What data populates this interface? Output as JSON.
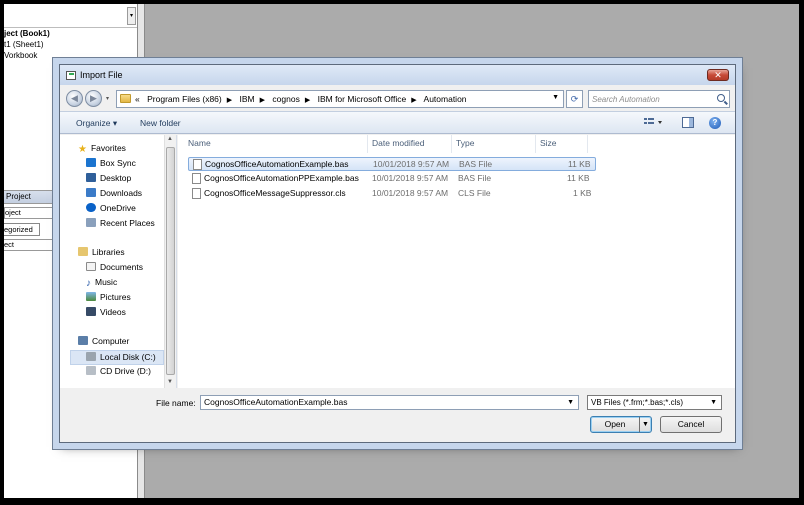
{
  "vba_pane": {
    "project_line": "ject (Book1)",
    "sheet_line": "t1 (Sheet1)",
    "workbook_line": "Vorkbook",
    "props_header": "Project",
    "props_combo": "oject",
    "props_tab": "egorized",
    "props_row": "ect"
  },
  "dialog": {
    "title": "Import File",
    "close_label": "✕",
    "address": {
      "crumbs": [
        "Program Files (x86)",
        "IBM",
        "cognos",
        "IBM for Microsoft Office",
        "Automation"
      ],
      "overflow": "«"
    },
    "search": {
      "placeholder": "Search Automation"
    },
    "toolbar": {
      "organize": "Organize ▾",
      "new_folder": "New folder",
      "help": "?"
    },
    "nav": {
      "favorites": "Favorites",
      "box_sync": "Box Sync",
      "desktop": "Desktop",
      "downloads": "Downloads",
      "onedrive": "OneDrive",
      "recent_places": "Recent Places",
      "libraries": "Libraries",
      "documents": "Documents",
      "music": "Music",
      "pictures": "Pictures",
      "videos": "Videos",
      "computer": "Computer",
      "local_disk": "Local Disk (C:)",
      "cd_drive": "CD Drive (D:)"
    },
    "columns": {
      "name": "Name",
      "date": "Date modified",
      "type": "Type",
      "size": "Size"
    },
    "files": [
      {
        "name": "CognosOfficeAutomationExample.bas",
        "date": "10/01/2018 9:57 AM",
        "type": "BAS File",
        "size": "11 KB"
      },
      {
        "name": "CognosOfficeAutomationPPExample.bas",
        "date": "10/01/2018 9:57 AM",
        "type": "BAS File",
        "size": "11 KB"
      },
      {
        "name": "CognosOfficeMessageSuppressor.cls",
        "date": "10/01/2018 9:57 AM",
        "type": "CLS File",
        "size": "1 KB"
      }
    ],
    "file_name_label": "File name:",
    "file_name_value": "CognosOfficeAutomationExample.bas",
    "file_type": "VB Files (*.frm;*.bas;*.cls)",
    "open_label": "Open",
    "cancel_label": "Cancel"
  }
}
